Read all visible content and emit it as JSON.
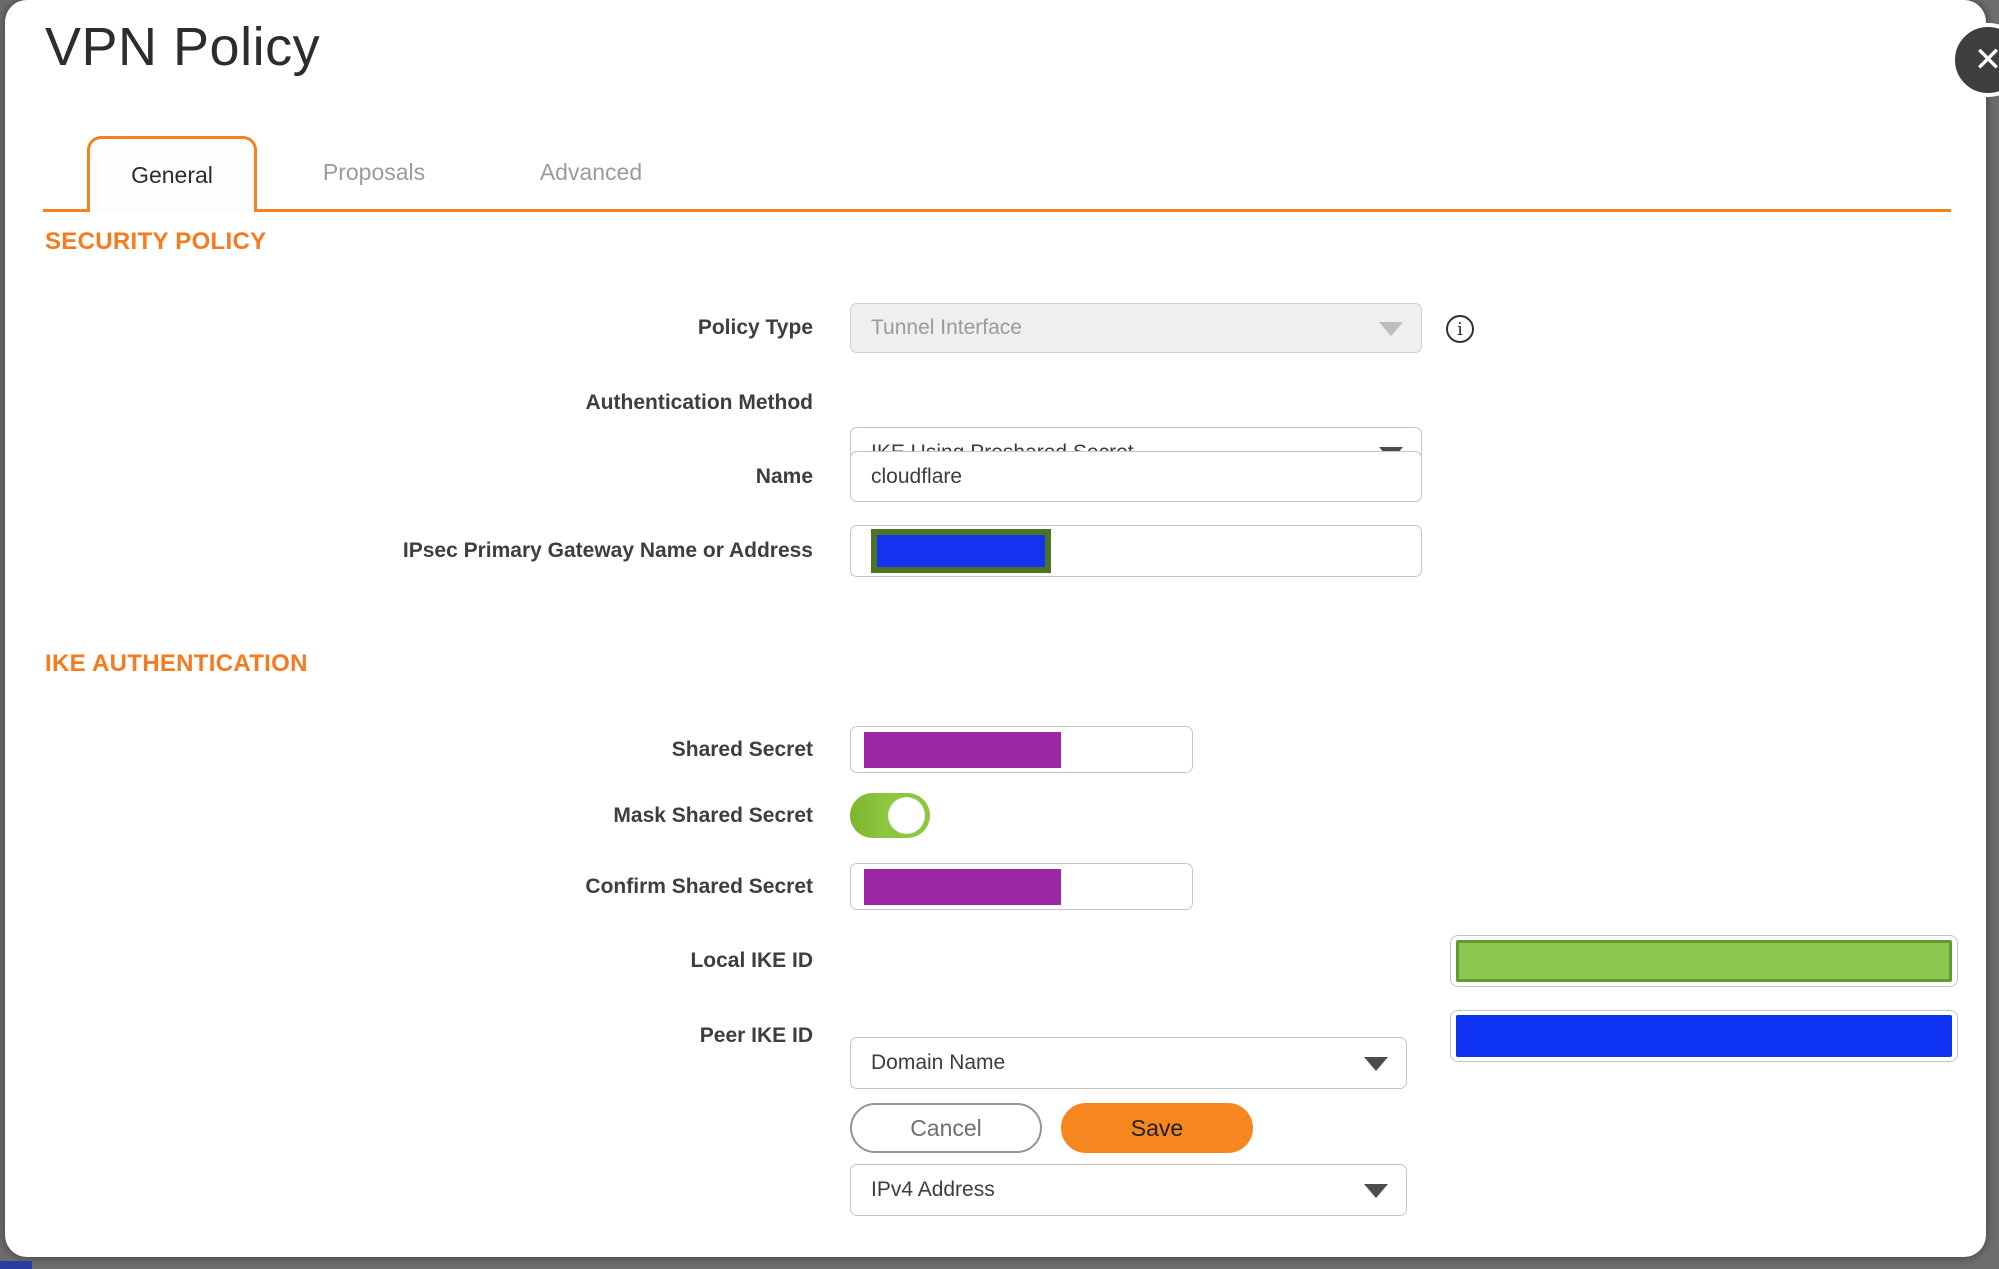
{
  "window": {
    "title": "VPN Policy",
    "close_glyph": "✕"
  },
  "tabs": {
    "active": "General",
    "items": [
      {
        "label": "General"
      },
      {
        "label": "Proposals"
      },
      {
        "label": "Advanced"
      }
    ]
  },
  "security_policy": {
    "heading": "SECURITY POLICY",
    "policy_type": {
      "label": "Policy Type",
      "value": "Tunnel Interface",
      "disabled": true
    },
    "authentication_method": {
      "label": "Authentication Method",
      "value": "IKE Using Preshared Secret"
    },
    "name": {
      "label": "Name",
      "value": "cloudflare"
    },
    "gateway": {
      "label": "IPsec Primary Gateway Name or Address",
      "value": "",
      "value_masked": true
    }
  },
  "ike_authentication": {
    "heading": "IKE AUTHENTICATION",
    "shared_secret": {
      "label": "Shared Secret",
      "value": "",
      "value_masked": true
    },
    "mask_shared_secret": {
      "label": "Mask Shared Secret",
      "state": "on"
    },
    "confirm_shared_secret": {
      "label": "Confirm Shared Secret",
      "value": "",
      "value_masked": true
    },
    "local_ike_id": {
      "label": "Local IKE ID",
      "value": "Domain Name",
      "id_value": "",
      "id_value_masked": true
    },
    "peer_ike_id": {
      "label": "Peer IKE ID",
      "value": "IPv4 Address",
      "id_value": "",
      "id_value_masked": true
    }
  },
  "buttons": {
    "cancel": "Cancel",
    "save": "Save"
  },
  "icons": {
    "info": "i"
  },
  "colors": {
    "accent_orange": "#f4801f",
    "save_orange": "#f6871f",
    "heading_orange": "#f47b20",
    "toggle_green": "#8dc63f",
    "redaction_purple": "#9b27a4",
    "redaction_blue": "#0d32f2",
    "redaction_green": "#8cc750",
    "redaction_green_border": "#639a2e",
    "redaction_olive_border": "#4d7326",
    "backdrop_gray": "#6d6d6d"
  }
}
